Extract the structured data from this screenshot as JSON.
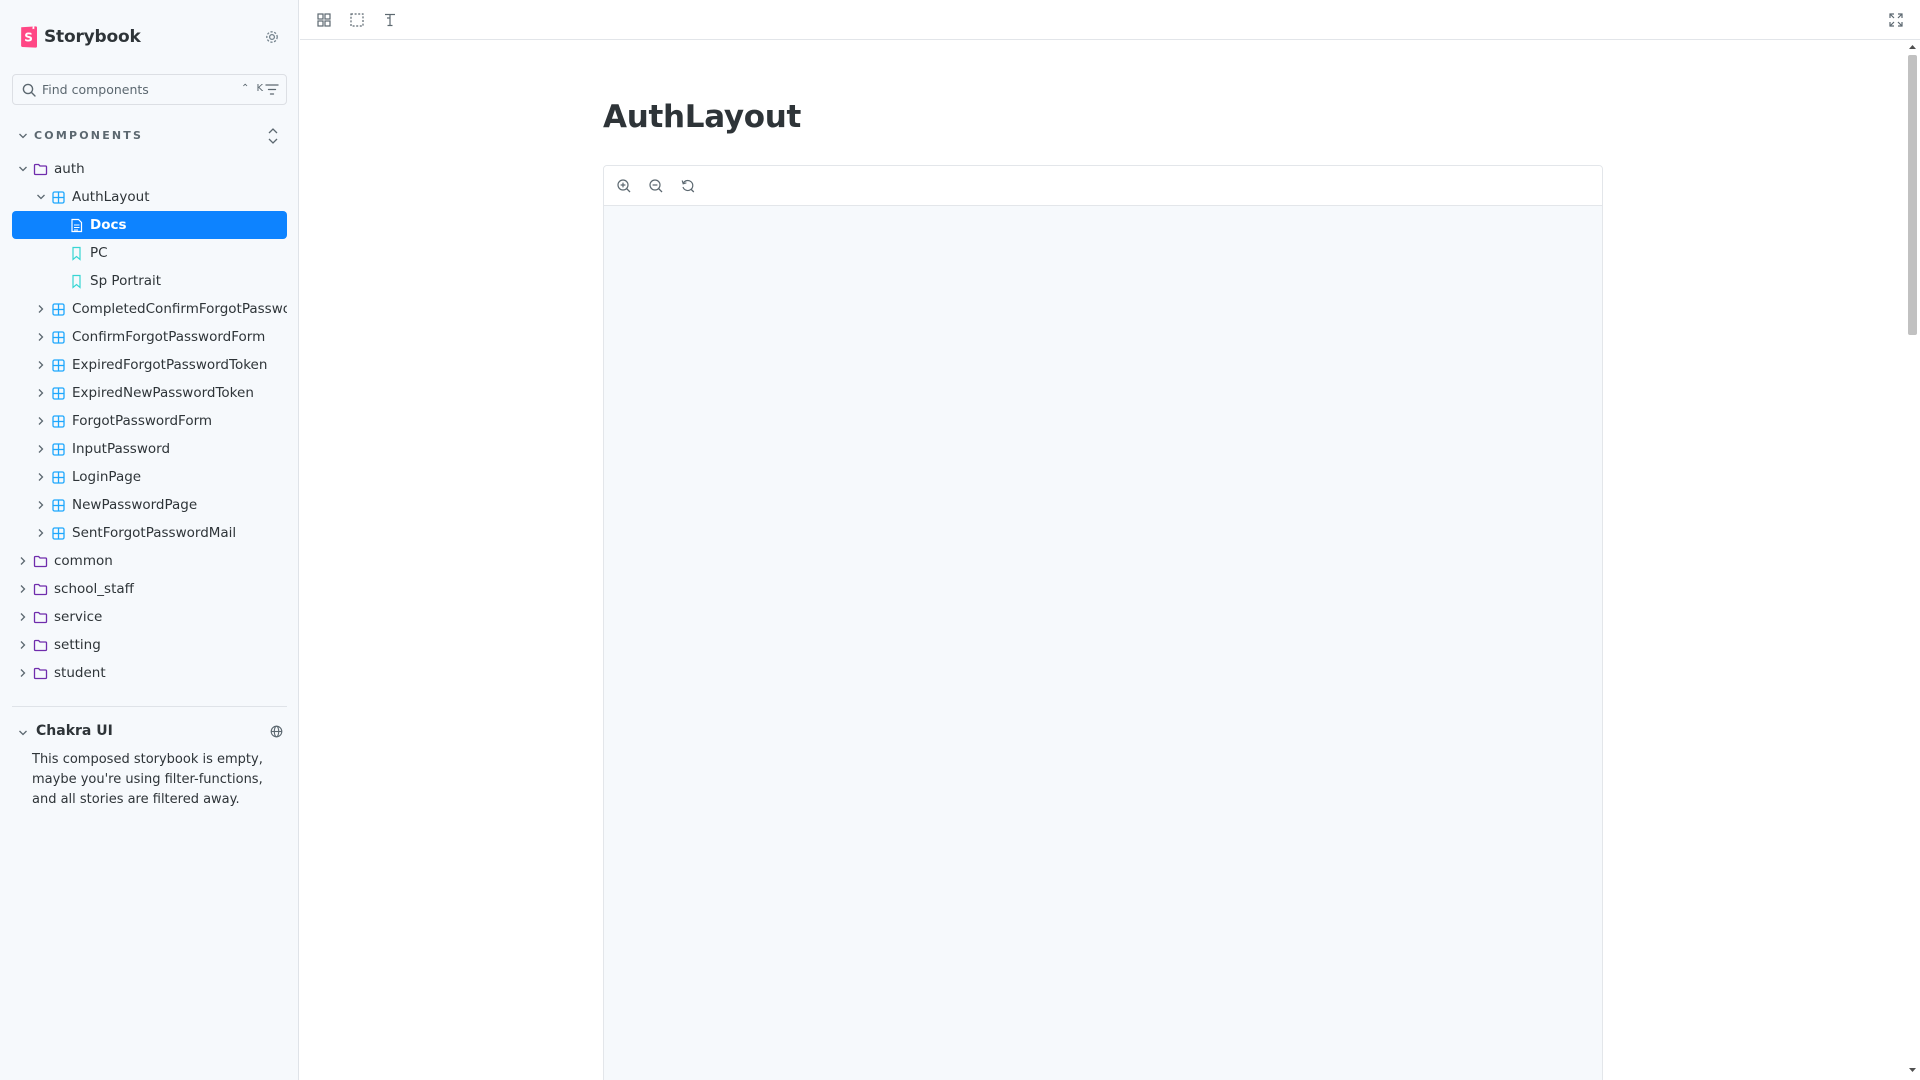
{
  "brand": {
    "name": "Storybook",
    "color": "#ff4785"
  },
  "search": {
    "placeholder": "Find components",
    "shortcut": "⌃ K"
  },
  "sidebar": {
    "section_title": "COMPONENTS",
    "tree": [
      {
        "label": "auth",
        "type": "folder",
        "depth": 0,
        "expanded": true
      },
      {
        "label": "AuthLayout",
        "type": "component",
        "depth": 1,
        "expanded": true
      },
      {
        "label": "Docs",
        "type": "docs",
        "depth": 2,
        "selected": true
      },
      {
        "label": "PC",
        "type": "story",
        "depth": 2
      },
      {
        "label": "Sp Portrait",
        "type": "story",
        "depth": 2
      },
      {
        "label": "CompletedConfirmForgotPasswordForm",
        "type": "component",
        "depth": 1,
        "expanded": false
      },
      {
        "label": "ConfirmForgotPasswordForm",
        "type": "component",
        "depth": 1,
        "expanded": false
      },
      {
        "label": "ExpiredForgotPasswordToken",
        "type": "component",
        "depth": 1,
        "expanded": false
      },
      {
        "label": "ExpiredNewPasswordToken",
        "type": "component",
        "depth": 1,
        "expanded": false
      },
      {
        "label": "ForgotPasswordForm",
        "type": "component",
        "depth": 1,
        "expanded": false
      },
      {
        "label": "InputPassword",
        "type": "component",
        "depth": 1,
        "expanded": false
      },
      {
        "label": "LoginPage",
        "type": "component",
        "depth": 1,
        "expanded": false
      },
      {
        "label": "NewPasswordPage",
        "type": "component",
        "depth": 1,
        "expanded": false
      },
      {
        "label": "SentForgotPasswordMail",
        "type": "component",
        "depth": 1,
        "expanded": false
      },
      {
        "label": "common",
        "type": "folder",
        "depth": 0,
        "expanded": false
      },
      {
        "label": "school_staff",
        "type": "folder",
        "depth": 0,
        "expanded": false
      },
      {
        "label": "service",
        "type": "folder",
        "depth": 0,
        "expanded": false
      },
      {
        "label": "setting",
        "type": "folder",
        "depth": 0,
        "expanded": false
      },
      {
        "label": "student",
        "type": "folder",
        "depth": 0,
        "expanded": false
      }
    ],
    "ref": {
      "title": "Chakra UI",
      "message": "This composed storybook is empty, maybe you're using filter-functions, and all stories are filtered away."
    }
  },
  "toolbar": {
    "left_icons": [
      "grid-icon",
      "outline-icon",
      "measure-icon"
    ],
    "right_icons": [
      "fullscreen-icon"
    ]
  },
  "docs": {
    "title": "AuthLayout",
    "canvas_tools": [
      "zoom-in-icon",
      "zoom-out-icon",
      "zoom-reset-icon"
    ]
  },
  "colors": {
    "sidebar_bg": "#f6f9fc",
    "selected_bg": "#0d83ff",
    "component_icon": "#1ea7fd",
    "story_icon": "#37d5d3",
    "folder_icon": "#6f2cac"
  }
}
